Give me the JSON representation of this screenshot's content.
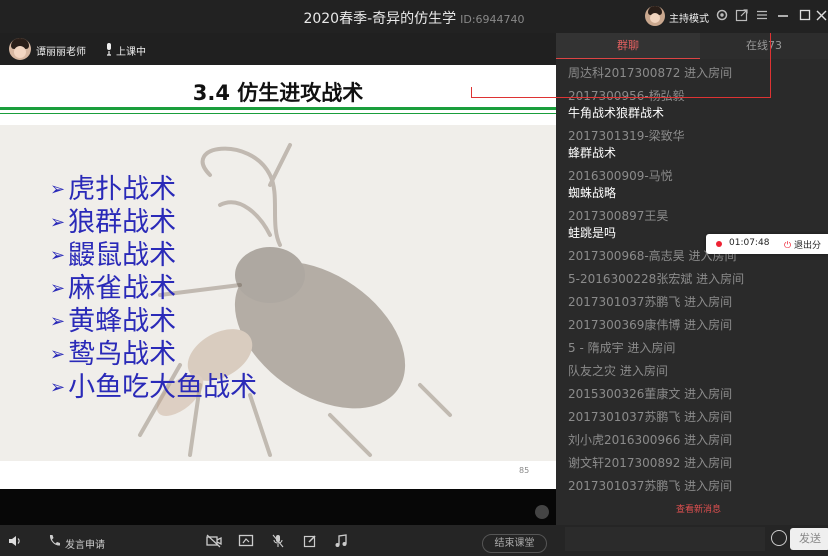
{
  "window": {
    "title": "2020春季-奇异的仿生学",
    "room_id": "ID:6944740",
    "host_mode": "主持模式"
  },
  "header": {
    "teacher_name": "谭丽丽老师",
    "status": "上课中"
  },
  "slide": {
    "title": "3.4  仿生进攻战术",
    "bullets": [
      "虎扑战术",
      "狼群战术",
      "鼹鼠战术",
      "麻雀战术",
      "黄蜂战术",
      "鸷鸟战术",
      "小鱼吃大鱼战术"
    ],
    "page_number": "85",
    "accent_color": "#1a9e3c",
    "bullet_color": "#2a2ab8"
  },
  "panel": {
    "tabs": [
      "群聊",
      "在线73"
    ],
    "messages": [
      {
        "kind": "join",
        "text": "周达科2017300872 进入房间"
      },
      {
        "kind": "chat",
        "name": "2017300956-杨弘毅",
        "text": "牛角战术狼群战术"
      },
      {
        "kind": "chat",
        "name": "2017301319-梁致华",
        "text": "蜂群战术"
      },
      {
        "kind": "chat",
        "name": "2016300909-马悦",
        "text": "蜘蛛战略"
      },
      {
        "kind": "chat",
        "name": "2017300897王昊",
        "text": "蛙跳是吗"
      },
      {
        "kind": "join",
        "text": "2017300968-高志昊 进入房间"
      },
      {
        "kind": "join",
        "text": "5-2016300228张宏斌 进入房间"
      },
      {
        "kind": "join",
        "text": "2017301037苏鹏飞 进入房间"
      },
      {
        "kind": "join",
        "text": "2017300369康伟博 进入房间"
      },
      {
        "kind": "join",
        "text": "5 - 隋成宇  进入房间"
      },
      {
        "kind": "join",
        "text": "队友之灾 进入房间"
      },
      {
        "kind": "join",
        "text": "2015300326董康文 进入房间"
      },
      {
        "kind": "join",
        "text": "2017301037苏鹏飞 进入房间"
      },
      {
        "kind": "join",
        "text": "刘小虎2016300966 进入房间"
      },
      {
        "kind": "join",
        "text": "谢文轩2017300892 进入房间"
      },
      {
        "kind": "join",
        "text": "2017301037苏鹏飞 进入房间"
      }
    ],
    "view_new": "查看新消息"
  },
  "recording": {
    "time": "01:07:48",
    "exit_label": "退出分"
  },
  "toolbar": {
    "raise_hand_label": "发言申请",
    "end_class_label": "结束课堂",
    "send_label": "发送"
  }
}
